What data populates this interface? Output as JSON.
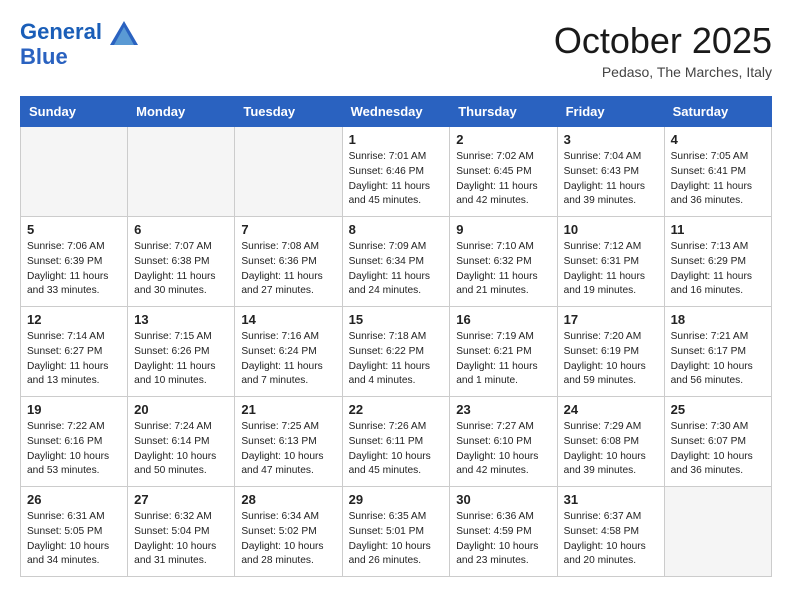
{
  "header": {
    "logo_line1": "General",
    "logo_line2": "Blue",
    "month": "October 2025",
    "location": "Pedaso, The Marches, Italy"
  },
  "weekdays": [
    "Sunday",
    "Monday",
    "Tuesday",
    "Wednesday",
    "Thursday",
    "Friday",
    "Saturday"
  ],
  "weeks": [
    [
      {
        "day": "",
        "info": ""
      },
      {
        "day": "",
        "info": ""
      },
      {
        "day": "",
        "info": ""
      },
      {
        "day": "1",
        "info": "Sunrise: 7:01 AM\nSunset: 6:46 PM\nDaylight: 11 hours and 45 minutes."
      },
      {
        "day": "2",
        "info": "Sunrise: 7:02 AM\nSunset: 6:45 PM\nDaylight: 11 hours and 42 minutes."
      },
      {
        "day": "3",
        "info": "Sunrise: 7:04 AM\nSunset: 6:43 PM\nDaylight: 11 hours and 39 minutes."
      },
      {
        "day": "4",
        "info": "Sunrise: 7:05 AM\nSunset: 6:41 PM\nDaylight: 11 hours and 36 minutes."
      }
    ],
    [
      {
        "day": "5",
        "info": "Sunrise: 7:06 AM\nSunset: 6:39 PM\nDaylight: 11 hours and 33 minutes."
      },
      {
        "day": "6",
        "info": "Sunrise: 7:07 AM\nSunset: 6:38 PM\nDaylight: 11 hours and 30 minutes."
      },
      {
        "day": "7",
        "info": "Sunrise: 7:08 AM\nSunset: 6:36 PM\nDaylight: 11 hours and 27 minutes."
      },
      {
        "day": "8",
        "info": "Sunrise: 7:09 AM\nSunset: 6:34 PM\nDaylight: 11 hours and 24 minutes."
      },
      {
        "day": "9",
        "info": "Sunrise: 7:10 AM\nSunset: 6:32 PM\nDaylight: 11 hours and 21 minutes."
      },
      {
        "day": "10",
        "info": "Sunrise: 7:12 AM\nSunset: 6:31 PM\nDaylight: 11 hours and 19 minutes."
      },
      {
        "day": "11",
        "info": "Sunrise: 7:13 AM\nSunset: 6:29 PM\nDaylight: 11 hours and 16 minutes."
      }
    ],
    [
      {
        "day": "12",
        "info": "Sunrise: 7:14 AM\nSunset: 6:27 PM\nDaylight: 11 hours and 13 minutes."
      },
      {
        "day": "13",
        "info": "Sunrise: 7:15 AM\nSunset: 6:26 PM\nDaylight: 11 hours and 10 minutes."
      },
      {
        "day": "14",
        "info": "Sunrise: 7:16 AM\nSunset: 6:24 PM\nDaylight: 11 hours and 7 minutes."
      },
      {
        "day": "15",
        "info": "Sunrise: 7:18 AM\nSunset: 6:22 PM\nDaylight: 11 hours and 4 minutes."
      },
      {
        "day": "16",
        "info": "Sunrise: 7:19 AM\nSunset: 6:21 PM\nDaylight: 11 hours and 1 minute."
      },
      {
        "day": "17",
        "info": "Sunrise: 7:20 AM\nSunset: 6:19 PM\nDaylight: 10 hours and 59 minutes."
      },
      {
        "day": "18",
        "info": "Sunrise: 7:21 AM\nSunset: 6:17 PM\nDaylight: 10 hours and 56 minutes."
      }
    ],
    [
      {
        "day": "19",
        "info": "Sunrise: 7:22 AM\nSunset: 6:16 PM\nDaylight: 10 hours and 53 minutes."
      },
      {
        "day": "20",
        "info": "Sunrise: 7:24 AM\nSunset: 6:14 PM\nDaylight: 10 hours and 50 minutes."
      },
      {
        "day": "21",
        "info": "Sunrise: 7:25 AM\nSunset: 6:13 PM\nDaylight: 10 hours and 47 minutes."
      },
      {
        "day": "22",
        "info": "Sunrise: 7:26 AM\nSunset: 6:11 PM\nDaylight: 10 hours and 45 minutes."
      },
      {
        "day": "23",
        "info": "Sunrise: 7:27 AM\nSunset: 6:10 PM\nDaylight: 10 hours and 42 minutes."
      },
      {
        "day": "24",
        "info": "Sunrise: 7:29 AM\nSunset: 6:08 PM\nDaylight: 10 hours and 39 minutes."
      },
      {
        "day": "25",
        "info": "Sunrise: 7:30 AM\nSunset: 6:07 PM\nDaylight: 10 hours and 36 minutes."
      }
    ],
    [
      {
        "day": "26",
        "info": "Sunrise: 6:31 AM\nSunset: 5:05 PM\nDaylight: 10 hours and 34 minutes."
      },
      {
        "day": "27",
        "info": "Sunrise: 6:32 AM\nSunset: 5:04 PM\nDaylight: 10 hours and 31 minutes."
      },
      {
        "day": "28",
        "info": "Sunrise: 6:34 AM\nSunset: 5:02 PM\nDaylight: 10 hours and 28 minutes."
      },
      {
        "day": "29",
        "info": "Sunrise: 6:35 AM\nSunset: 5:01 PM\nDaylight: 10 hours and 26 minutes."
      },
      {
        "day": "30",
        "info": "Sunrise: 6:36 AM\nSunset: 4:59 PM\nDaylight: 10 hours and 23 minutes."
      },
      {
        "day": "31",
        "info": "Sunrise: 6:37 AM\nSunset: 4:58 PM\nDaylight: 10 hours and 20 minutes."
      },
      {
        "day": "",
        "info": ""
      }
    ]
  ]
}
